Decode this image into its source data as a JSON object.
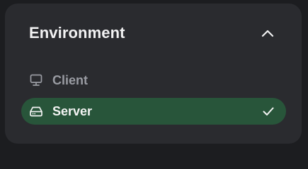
{
  "panel": {
    "title": "Environment",
    "collapse_icon": "chevron-up-icon",
    "options": [
      {
        "label": "Client",
        "icon": "monitor-icon",
        "selected": false
      },
      {
        "label": "Server",
        "icon": "hard-drive-icon",
        "selected": true
      }
    ]
  },
  "colors": {
    "background": "#1c1d20",
    "panel": "#2a2b2f",
    "selected_background": "#28553a",
    "title_text": "#f2f2f3",
    "muted_text": "#9a9ca3"
  }
}
